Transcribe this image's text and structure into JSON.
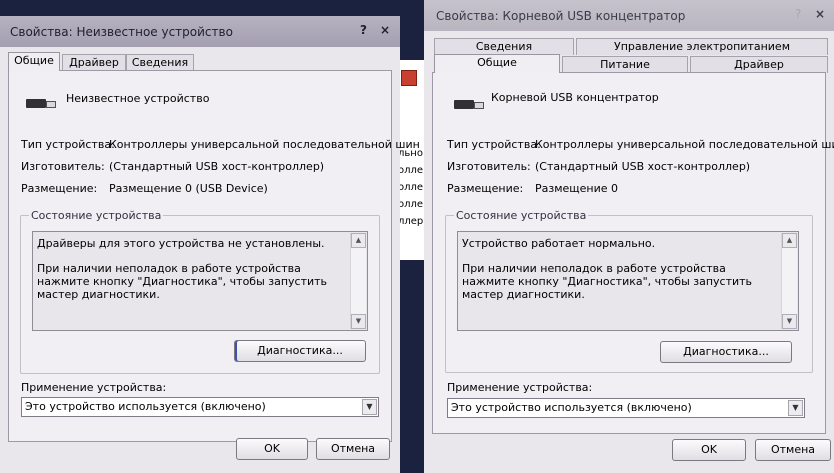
{
  "background_window": {
    "fragments": [
      "льно",
      "олле",
      "олле",
      "олле",
      "ллер"
    ]
  },
  "dialog1": {
    "title": "Свойства: Неизвестное устройство",
    "help_glyph": "?",
    "close_glyph": "×",
    "tabs": [
      "Общие",
      "Драйвер",
      "Сведения"
    ],
    "device_name": "Неизвестное устройство",
    "props": [
      {
        "label": "Тип устройства:",
        "value": "Контроллеры универсальной последовательной шин"
      },
      {
        "label": "Изготовитель:",
        "value": "(Стандартный USB хост-контроллер)"
      },
      {
        "label": "Размещение:",
        "value": "Размещение 0 (USB Device)"
      }
    ],
    "status_title": "Состояние устройства",
    "status_line1": "Драйверы для этого устройства не установлены.",
    "status_line2": "При наличии неполадок в работе устройства нажмите кнопку \"Диагностика\", чтобы запустить мастер диагностики.",
    "diag_button": "Диагностика...",
    "usage_label": "Применение устройства:",
    "usage_value": "Это устройство используется (включено)",
    "ok": "OK",
    "cancel": "Отмена"
  },
  "dialog2": {
    "title": "Свойства: Корневой USB концентратор",
    "help_glyph": "?",
    "close_glyph": "×",
    "tabs_row1": [
      "Сведения",
      "Управление электропитанием"
    ],
    "tabs_row2": [
      "Общие",
      "Питание",
      "Драйвер"
    ],
    "device_name": "Корневой USB концентратор",
    "props": [
      {
        "label": "Тип устройства:",
        "value": "Контроллеры универсальной последовательной шин"
      },
      {
        "label": "Изготовитель:",
        "value": "(Стандартный USB хост-контроллер)"
      },
      {
        "label": "Размещение:",
        "value": "Размещение 0"
      }
    ],
    "status_title": "Состояние устройства",
    "status_line1": "Устройство работает нормально.",
    "status_line2": "При наличии неполадок в работе устройства нажмите кнопку \"Диагностика\", чтобы запустить мастер диагностики.",
    "diag_button": "Диагностика...",
    "usage_label": "Применение устройства:",
    "usage_value": "Это устройство используется (включено)",
    "ok": "OK",
    "cancel": "Отмена"
  },
  "icons": {
    "device": "usb-device-icon",
    "scroll_up": "scroll-up-arrow-icon",
    "scroll_down": "scroll-down-arrow-icon",
    "dropdown": "chevron-down-icon",
    "background_app": "red-app-icon"
  },
  "colors": {
    "desktop": "#1a2240",
    "dialog_body": "#e9e6ec",
    "focus_edge": "#3b54a8"
  }
}
